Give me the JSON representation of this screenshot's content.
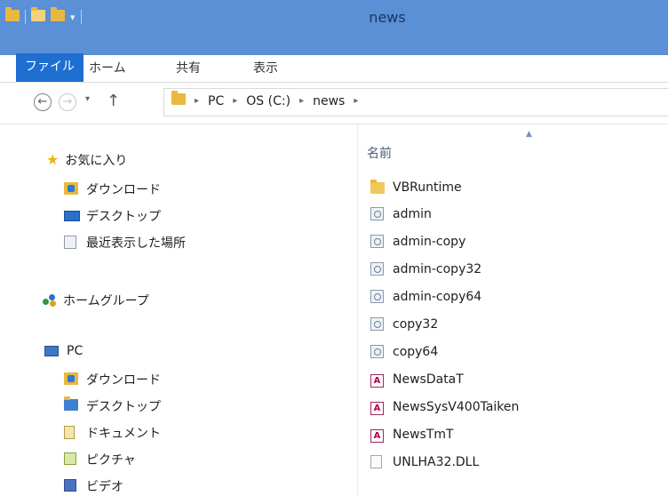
{
  "window": {
    "title": "news"
  },
  "ribbon": {
    "tabs": [
      "ファイル",
      "ホーム",
      "共有",
      "表示"
    ]
  },
  "address": {
    "crumbs": [
      "PC",
      "OS (C:)",
      "news"
    ]
  },
  "nav": {
    "favorites": {
      "label": "お気に入り",
      "items": [
        "ダウンロード",
        "デスクトップ",
        "最近表示した場所"
      ]
    },
    "homegroup": "ホームグループ",
    "pc": {
      "label": "PC",
      "items": [
        "ダウンロード",
        "デスクトップ",
        "ドキュメント",
        "ピクチャ",
        "ビデオ"
      ]
    }
  },
  "filelist": {
    "column_name": "名前",
    "files": [
      {
        "name": "VBRuntime",
        "icon": "folder-icon"
      },
      {
        "name": "admin",
        "icon": "application-icon"
      },
      {
        "name": "admin-copy",
        "icon": "application-icon"
      },
      {
        "name": "admin-copy32",
        "icon": "application-icon"
      },
      {
        "name": "admin-copy64",
        "icon": "application-icon"
      },
      {
        "name": "copy32",
        "icon": "application-icon"
      },
      {
        "name": "copy64",
        "icon": "application-icon"
      },
      {
        "name": "NewsDataT",
        "icon": "access-database-icon"
      },
      {
        "name": "NewsSysV400Taiken",
        "icon": "access-database-icon"
      },
      {
        "name": "NewsTmT",
        "icon": "access-database-icon"
      },
      {
        "name": "UNLHA32.DLL",
        "icon": "dll-file-icon"
      }
    ]
  },
  "colors": {
    "titlebar": "#5b8fd6",
    "file_tab": "#1e6fd1"
  }
}
